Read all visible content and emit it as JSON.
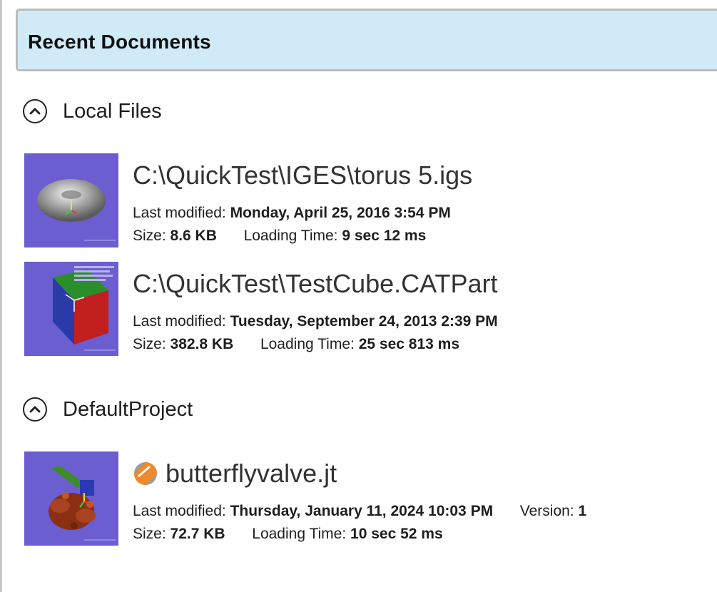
{
  "header": {
    "title": "Recent Documents"
  },
  "sections": [
    {
      "title": "Local Files",
      "items": [
        {
          "path": "C:\\QuickTest\\IGES\\torus 5.igs",
          "modified_label": "Last modified:",
          "modified": "Monday, April 25, 2016 3:54 PM",
          "size_label": "Size:",
          "size": "8.6 KB",
          "loading_label": "Loading Time:",
          "loading": "9 sec 12 ms",
          "thumbnail": "torus-thumbnail"
        },
        {
          "path": "C:\\QuickTest\\TestCube.CATPart",
          "modified_label": "Last modified:",
          "modified": "Tuesday, September 24, 2013 2:39 PM",
          "size_label": "Size:",
          "size": "382.8 KB",
          "loading_label": "Loading Time:",
          "loading": "25 sec 813 ms",
          "thumbnail": "cube-thumbnail"
        }
      ]
    },
    {
      "title": "DefaultProject",
      "items": [
        {
          "path": "butterflyvalve.jt",
          "file_icon": "jt-file-icon",
          "modified_label": "Last modified:",
          "modified": "Thursday, January 11, 2024 10:03 PM",
          "version_label": "Version:",
          "version": "1",
          "size_label": "Size:",
          "size": "72.7 KB",
          "loading_label": "Loading Time:",
          "loading": "10 sec 52 ms",
          "thumbnail": "valve-thumbnail"
        }
      ]
    }
  ],
  "colors": {
    "header_bg": "#d1eaf7",
    "thumbnail_bg": "#6a5ed0",
    "jt_icon_orange": "#f0892a"
  },
  "icons": {
    "collapse": "chevron-up-circle-icon"
  }
}
